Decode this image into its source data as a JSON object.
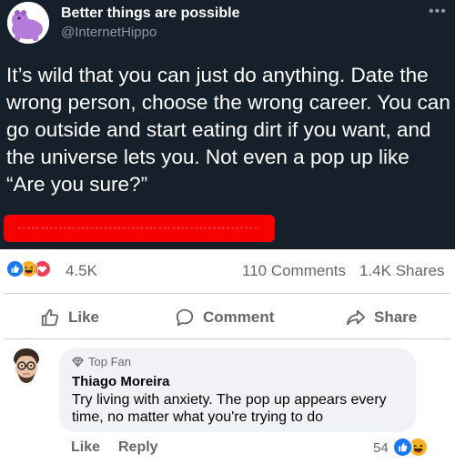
{
  "tweet": {
    "display_name": "Better things are possible",
    "handle": "@InternetHippo",
    "more_icon": "•••",
    "text": "It’s wild that you can just do anything. Date the wrong person, choose the wrong career. You can go outside and start eating dirt if you want, and the universe lets you. Not even a pop up like “Are you sure?”",
    "redaction_color": "#f80000"
  },
  "post_stats": {
    "reaction_icons": [
      "like-icon",
      "haha-icon",
      "love-icon"
    ],
    "reactions": "4.5K",
    "comments": "110 Comments",
    "shares": "1.4K Shares"
  },
  "actions": {
    "like": "Like",
    "comment": "Comment",
    "share": "Share"
  },
  "comment": {
    "badge": "Top Fan",
    "author": "Thiago Moreira",
    "text": "Try living with anxiety. The pop up appears every time, no matter what you're trying to do",
    "like": "Like",
    "reply": "Reply",
    "reaction_count": "54",
    "reaction_icons": [
      "like-icon",
      "haha-icon"
    ]
  },
  "colors": {
    "tweet_bg": "#15202b",
    "fb_like_blue": "#1877f2",
    "fb_love_red": "#f33e58",
    "fb_haha_yellow": "#f7b125",
    "fb_secondary_text": "#65676b"
  }
}
